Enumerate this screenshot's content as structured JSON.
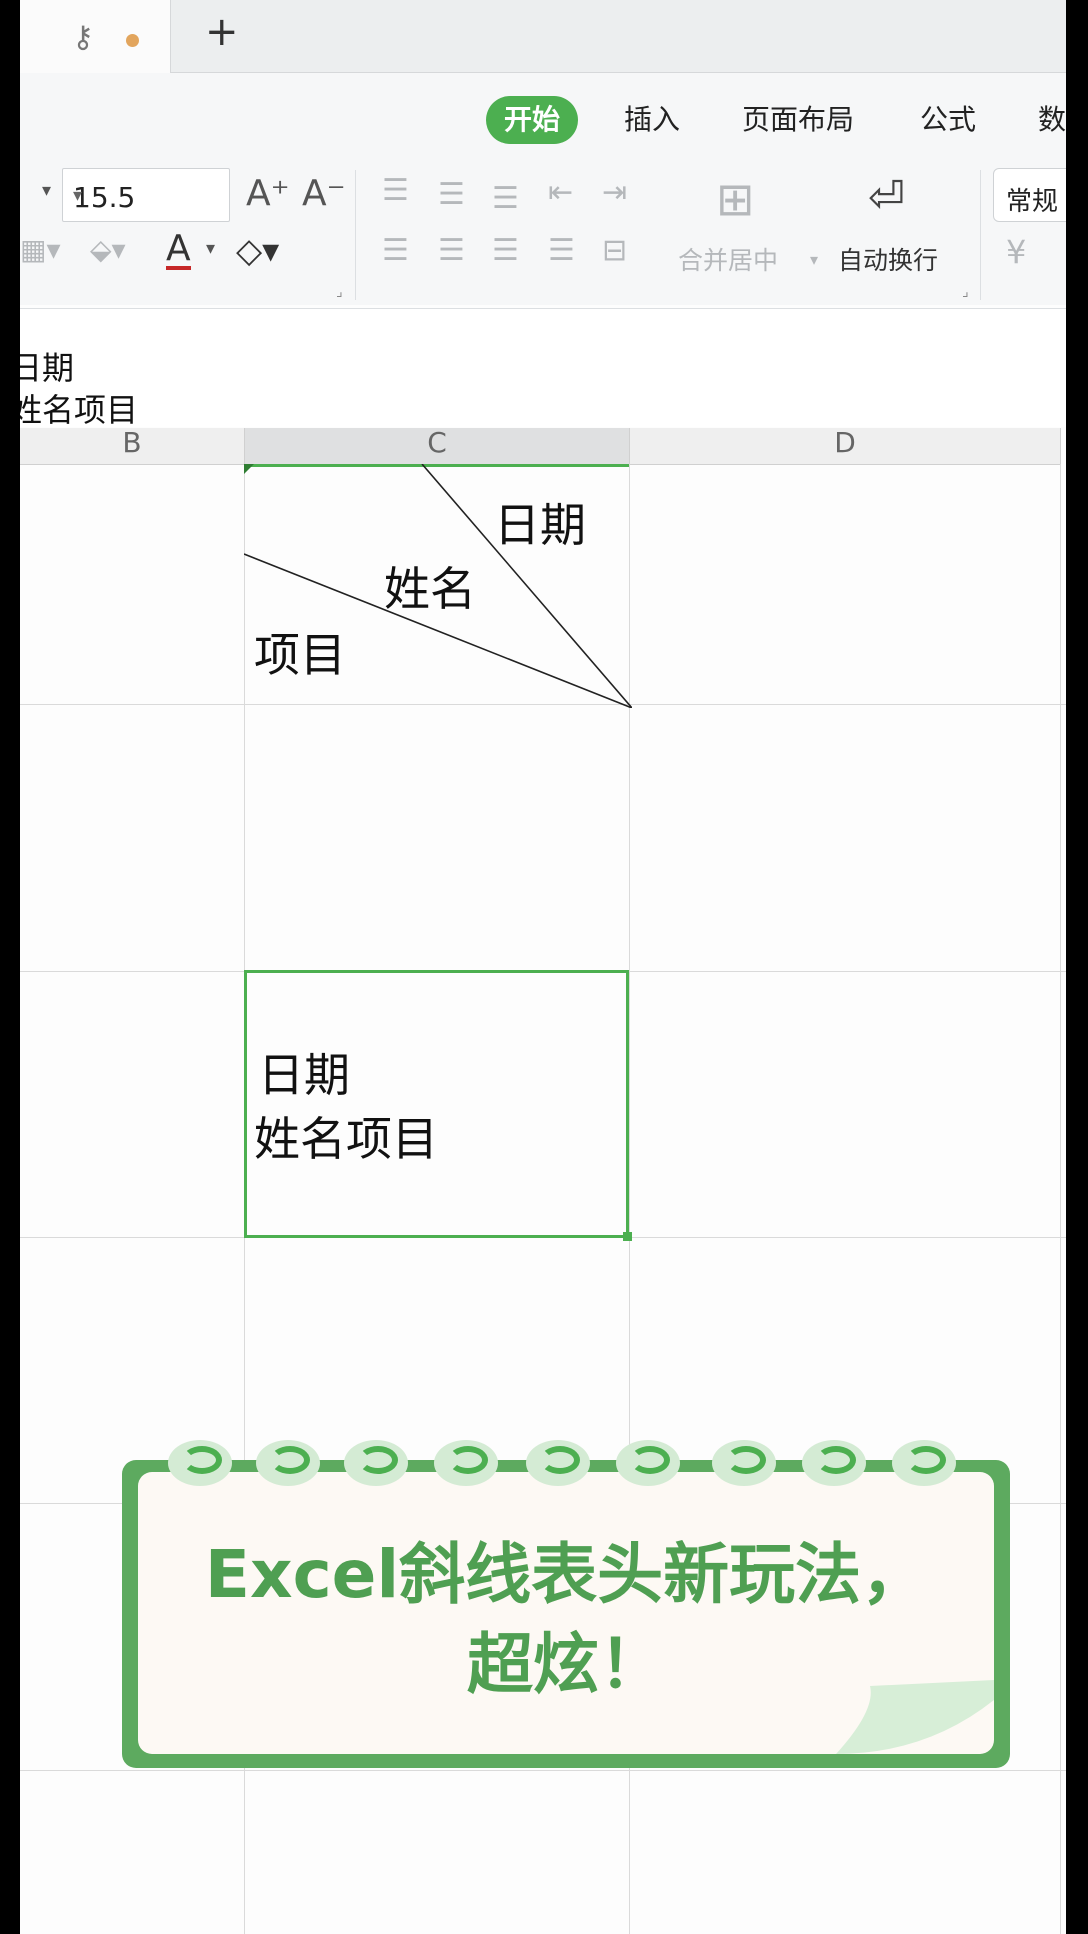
{
  "tabbar": {
    "key_icon": "key-icon",
    "new_tab": "+"
  },
  "menu": {
    "start": "开始",
    "insert": "插入",
    "page_layout": "页面布局",
    "formula": "公式",
    "data": "数"
  },
  "toolbar": {
    "font_size": "15.5",
    "increase_font": "A⁺",
    "decrease_font": "A⁻",
    "merge_center": "合并居中",
    "wrap_text": "自动换行",
    "number_format": "常规",
    "currency": "¥"
  },
  "formula_bar": {
    "line1": "日期",
    "line2": "姓名项目"
  },
  "columns": {
    "b": "B",
    "c": "C",
    "d": "D"
  },
  "header_cell": {
    "date": "日期",
    "name": "姓名",
    "item": "项目"
  },
  "active_cell": {
    "line1": "日期",
    "line2": "姓名项目"
  },
  "banner": {
    "line1": "Excel斜线表头新玩法，",
    "line2": "超炫！"
  },
  "colors": {
    "accent": "#4caf50",
    "banner_green": "#5daa5f",
    "modified_dot": "#e2a55d"
  }
}
